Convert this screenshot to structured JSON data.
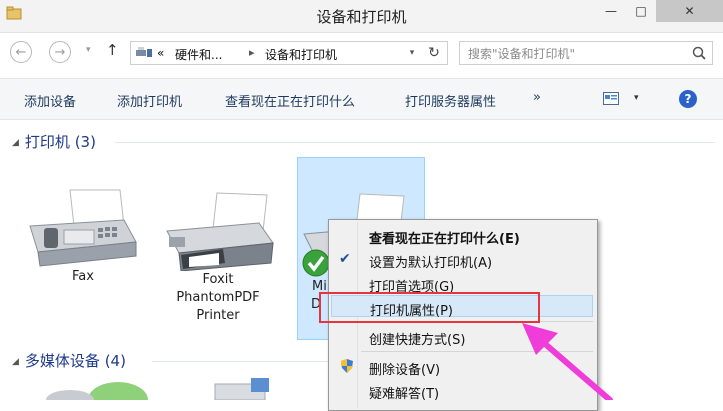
{
  "window": {
    "title": "设备和打印机",
    "min_glyph": "—",
    "max_glyph": "□",
    "close_glyph": "✕"
  },
  "address": {
    "back_glyph": "←",
    "forward_glyph": "→",
    "dropdown_glyph": "▾",
    "up_glyph": "↑",
    "overflow_glyph": "«",
    "breadcrumb_sep": "▸",
    "breadcrumb": [
      "硬件和...",
      "设备和打印机"
    ],
    "refresh_glyph": "↻",
    "search_placeholder": "搜索\"设备和打印机\""
  },
  "toolbar": {
    "items": [
      "添加设备",
      "添加打印机",
      "查看现在正在打印什么",
      "打印服务器属性"
    ],
    "more_glyph": "»",
    "view_dropdown_glyph": "▾",
    "help_glyph": "?"
  },
  "groups": {
    "caret_glyph": "◢",
    "printers_header": "打印机 (3)",
    "multimedia_header": "多媒体设备 (4)"
  },
  "devices": {
    "fax": "Fax",
    "foxit_line1": "Foxit",
    "foxit_line2": "PhantomPDF",
    "foxit_line3": "Printer",
    "selected_fragment1": "Mi",
    "selected_fragment2": "D"
  },
  "context_menu": {
    "items": [
      {
        "label": "查看现在正在打印什么(E)",
        "bold": true
      },
      {
        "label": "设置为默认打印机(A)",
        "checked": true
      },
      {
        "label": "打印首选项(G)"
      },
      {
        "label": "打印机属性(P)",
        "highlighted": true
      },
      {
        "label": "创建快捷方式(S)"
      },
      {
        "label": "删除设备(V)",
        "icon": "uac-shield-icon"
      },
      {
        "label": "疑难解答(T)"
      }
    ],
    "check_glyph": "✔"
  },
  "colors": {
    "accent": "#1e3a8a",
    "selection": "#cde8ff",
    "highlight_box": "#e8343c",
    "annotation_arrow": "#f03cd8"
  }
}
